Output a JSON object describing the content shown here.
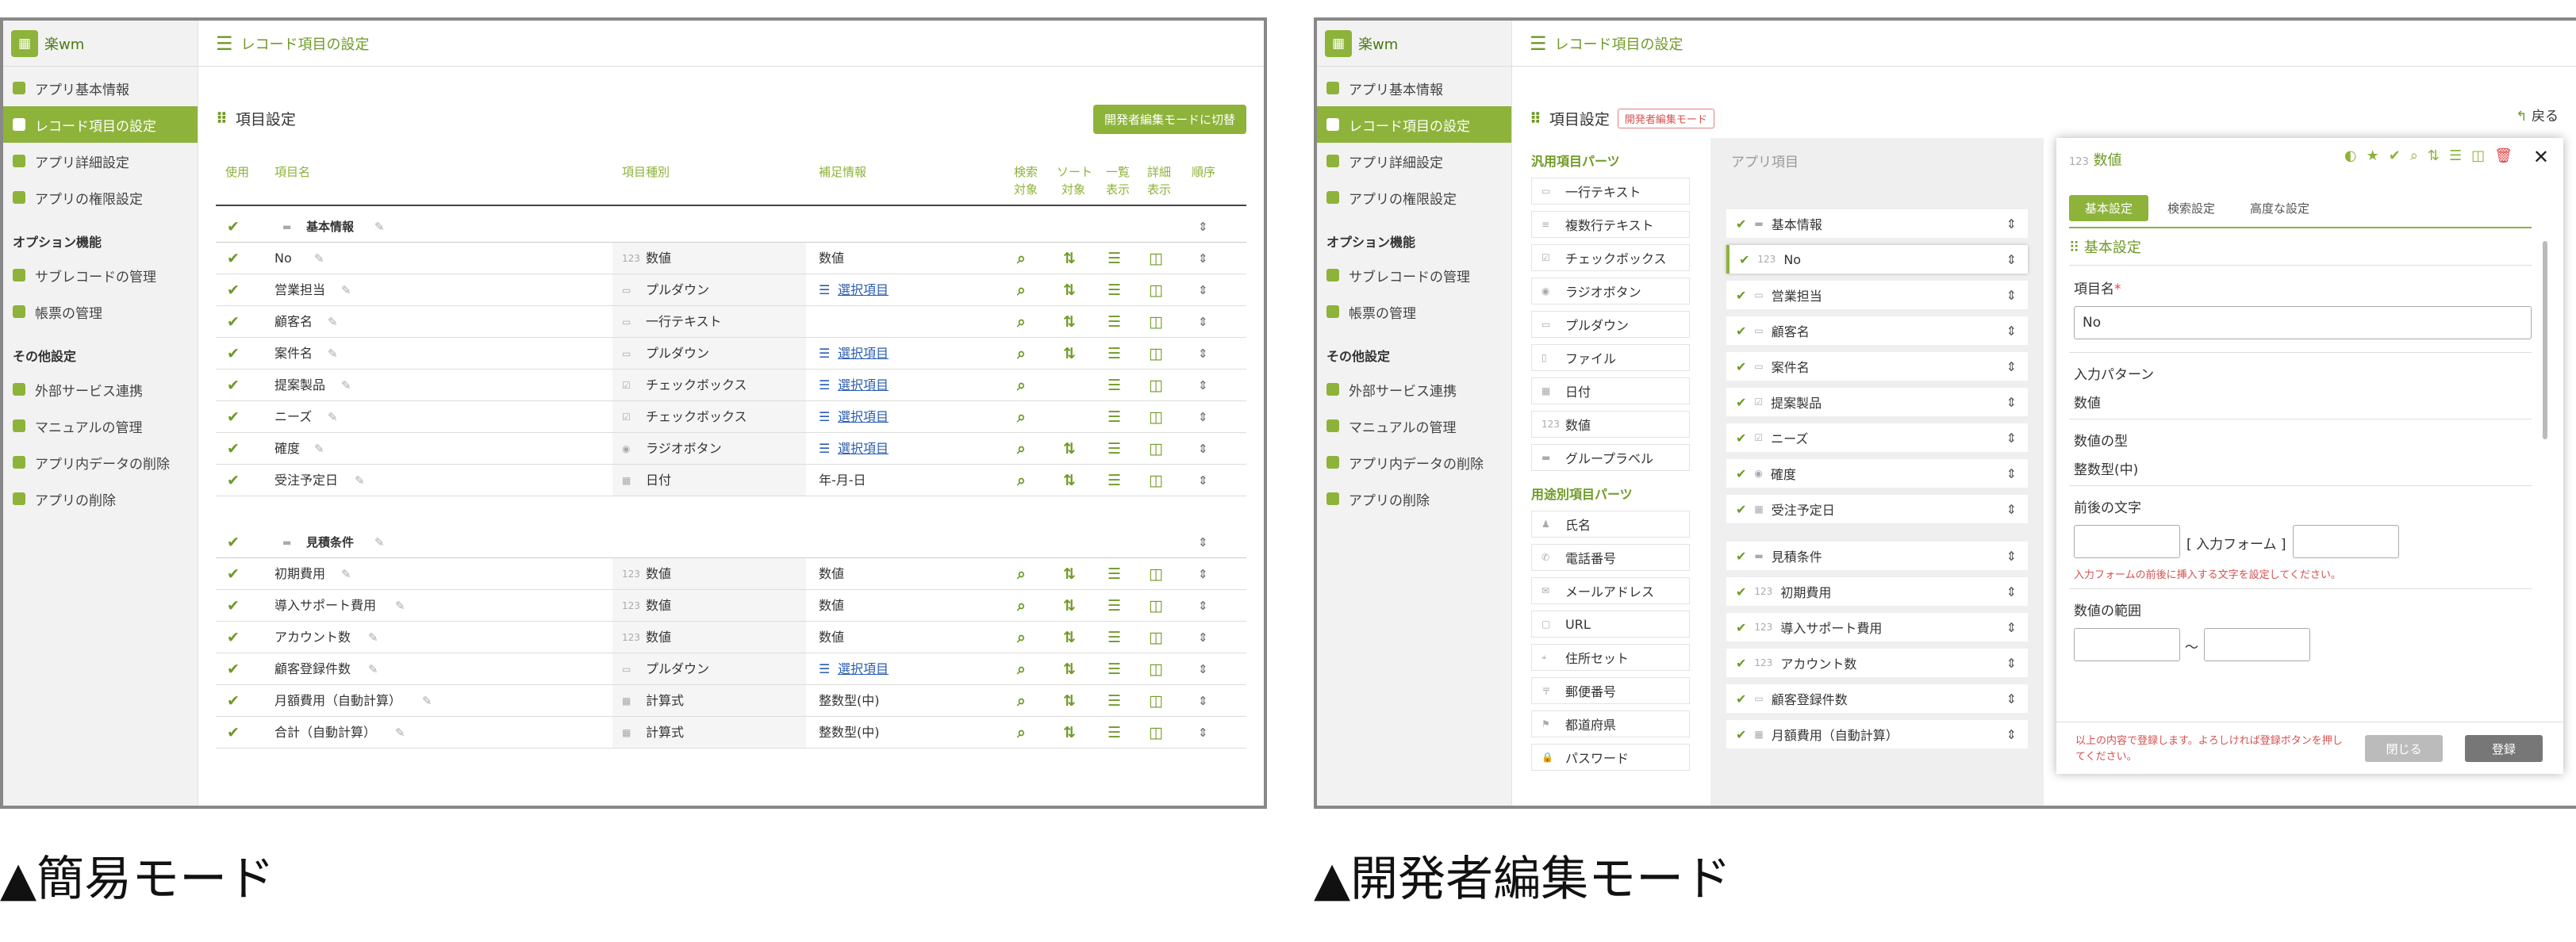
{
  "logo": {
    "text": "楽wm"
  },
  "sidebar": {
    "items": [
      "アプリ基本情報",
      "レコード項目の設定",
      "アプリ詳細設定",
      "アプリの権限設定"
    ],
    "option_heading": "オプション機能",
    "option_items": [
      "サブレコードの管理",
      "帳票の管理"
    ],
    "other_heading": "その他設定",
    "other_items": [
      "外部サービス連携",
      "マニュアルの管理",
      "アプリ内データの削除",
      "アプリの削除"
    ]
  },
  "header": {
    "title": "レコード項目の設定"
  },
  "simple": {
    "section_title": "項目設定",
    "dev_button": "開発者編集モードに切替",
    "columns": {
      "use": "使用",
      "name": "項目名",
      "type": "項目種別",
      "info": "補足情報",
      "search1": "検索",
      "search2": "対象",
      "sort1": "ソート",
      "sort2": "対象",
      "list1": "一覧",
      "list2": "表示",
      "detail1": "詳細",
      "detail2": "表示",
      "order": "順序"
    },
    "group1": "基本情報",
    "group2": "見積条件",
    "rows1": [
      {
        "name": "No",
        "type": "数値",
        "info": "数値",
        "link": false,
        "sort": true
      },
      {
        "name": "営業担当",
        "type": "プルダウン",
        "info": "選択項目",
        "link": true,
        "sort": true
      },
      {
        "name": "顧客名",
        "type": "一行テキスト",
        "info": "",
        "link": false,
        "sort": true
      },
      {
        "name": "案件名",
        "type": "プルダウン",
        "info": "選択項目",
        "link": true,
        "sort": true
      },
      {
        "name": "提案製品",
        "type": "チェックボックス",
        "info": "選択項目",
        "link": true,
        "sort": false
      },
      {
        "name": "ニーズ",
        "type": "チェックボックス",
        "info": "選択項目",
        "link": true,
        "sort": false
      },
      {
        "name": "確度",
        "type": "ラジオボタン",
        "info": "選択項目",
        "link": true,
        "sort": true
      },
      {
        "name": "受注予定日",
        "type": "日付",
        "info": "年-月-日",
        "link": false,
        "sort": true
      }
    ],
    "rows2": [
      {
        "name": "初期費用",
        "type": "数値",
        "info": "数値",
        "link": false,
        "sort": true
      },
      {
        "name": "導入サポート費用",
        "type": "数値",
        "info": "数値",
        "link": false,
        "sort": true
      },
      {
        "name": "アカウント数",
        "type": "数値",
        "info": "数値",
        "link": false,
        "sort": true
      },
      {
        "name": "顧客登録件数",
        "type": "プルダウン",
        "info": "選択項目",
        "link": true,
        "sort": true
      },
      {
        "name": "月額費用（自動計算）",
        "type": "計算式",
        "info": "整数型(中)",
        "link": false,
        "sort": true
      },
      {
        "name": "合計（自動計算）",
        "type": "計算式",
        "info": "整数型(中)",
        "link": false,
        "sort": true
      }
    ]
  },
  "dev": {
    "section_title": "項目設定",
    "badge": "開発者編集モード",
    "back": "戻る",
    "general_heading": "汎用項目パーツ",
    "general_parts": [
      "一行テキスト",
      "複数行テキスト",
      "チェックボックス",
      "ラジオボタン",
      "プルダウン",
      "ファイル",
      "日付",
      "数値",
      "グループラベル"
    ],
    "usage_heading": "用途別項目パーツ",
    "usage_parts": [
      "氏名",
      "電話番号",
      "メールアドレス",
      "URL",
      "住所セット",
      "郵便番号",
      "都道府県",
      "パスワード"
    ],
    "app_items_heading": "アプリ項目",
    "app_items": [
      "基本情報",
      "No",
      "営業担当",
      "顧客名",
      "案件名",
      "提案製品",
      "ニーズ",
      "確度",
      "受注予定日",
      "見積条件",
      "初期費用",
      "導入サポート費用",
      "アカウント数",
      "顧客登録件数",
      "月額費用（自動計算）"
    ],
    "modal": {
      "icon_text": "123",
      "title": "数値",
      "tabs": [
        "基本設定",
        "検索設定",
        "高度な設定"
      ],
      "section": "基本設定",
      "name_label": "項目名",
      "required_mark": "*",
      "name_value": "No",
      "pattern_label": "入力パターン",
      "pattern_value": "数値",
      "numtype_label": "数値の型",
      "numtype_value": "整数型(中)",
      "affix_label": "前後の文字",
      "affix_mid": "[ 入力フォーム ]",
      "affix_note": "入力フォームの前後に挿入する文字を設定してください。",
      "range_label": "数値の範囲",
      "range_sep": "〜",
      "footer_note": "以上の内容で登録します。よろしければ登録ボタンを押してください。",
      "close_button": "閉じる",
      "register_button": "登録"
    }
  },
  "captions": {
    "left": "▲簡易モード",
    "right": "▲開発者編集モード"
  }
}
